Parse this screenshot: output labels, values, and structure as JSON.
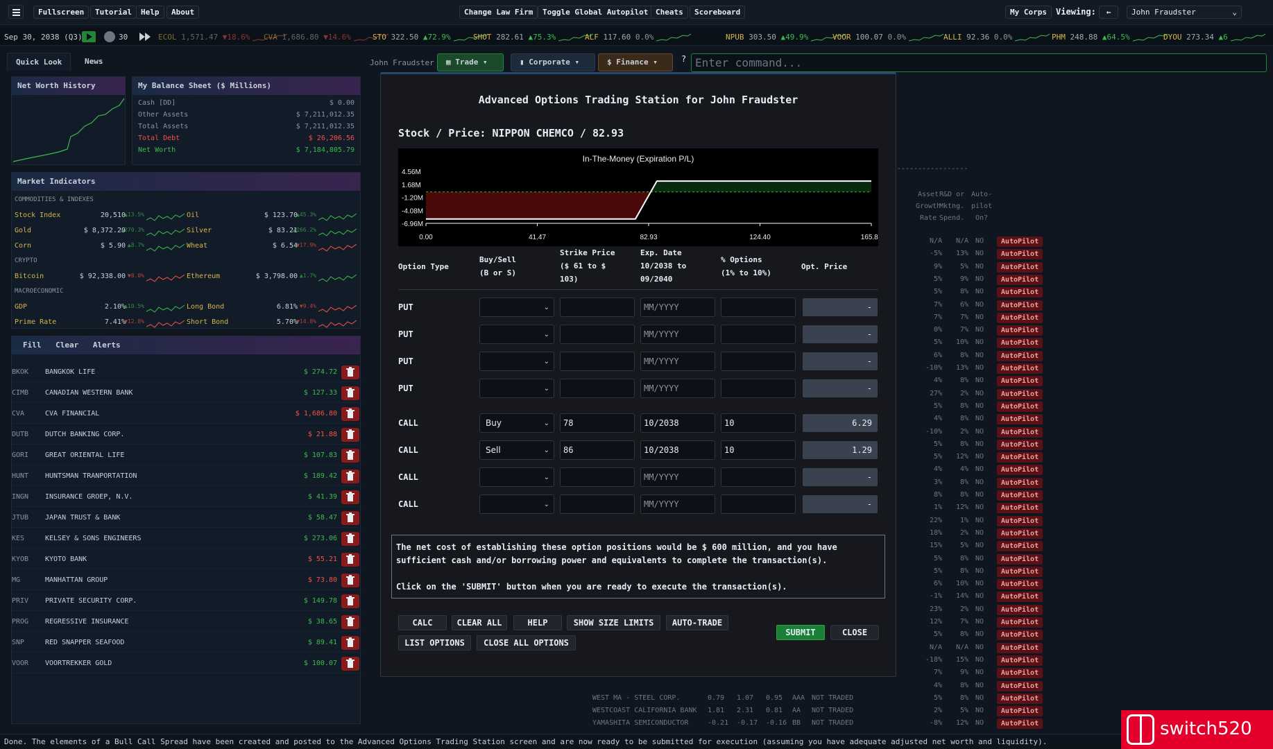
{
  "topbar": {
    "menu": [
      "Fullscreen",
      "Tutorial",
      "Help",
      "About"
    ],
    "center": [
      "Change Law Firm",
      "Toggle Global Autopilot",
      "Cheats",
      "Scoreboard"
    ],
    "my_corps": "My Corps",
    "viewing_label": "Viewing:",
    "back_label": "←",
    "viewing_value": "John Fraudster"
  },
  "ticker": {
    "date": "Sep 30, 2038 (Q3)",
    "speed": "30",
    "items": [
      {
        "sym": "ECOL",
        "price": "1,571.47",
        "chg": "▼18.6%",
        "dir": "dn"
      },
      {
        "sym": "CVA",
        "price": "1,686.80",
        "chg": "▼14.6%",
        "dir": "dn"
      },
      {
        "sym": "STO",
        "price": "322.50",
        "chg": "▲72.9%",
        "dir": "up"
      },
      {
        "sym": "SHOT",
        "price": "282.61",
        "chg": "▲75.3%",
        "dir": "up"
      },
      {
        "sym": "ALF",
        "price": "117.60",
        "chg": "0.0%",
        "dir": "gr"
      },
      {
        "sym": "NPUB",
        "price": "303.50",
        "chg": "▲49.9%",
        "dir": "up"
      },
      {
        "sym": "VOOR",
        "price": "100.07",
        "chg": "0.0%",
        "dir": "gr"
      },
      {
        "sym": "ALLI",
        "price": "92.36",
        "chg": "0.0%",
        "dir": "gr"
      },
      {
        "sym": "PHM",
        "price": "248.88",
        "chg": "▲64.5%",
        "dir": "up"
      },
      {
        "sym": "DYOU",
        "price": "273.34",
        "chg": "▲6",
        "dir": "up"
      }
    ]
  },
  "left": {
    "tabs": [
      "Quick Look",
      "News"
    ],
    "nw_title": "Net Worth History",
    "bs_title": "My Balance Sheet ($ Millions)",
    "bs_rows": [
      {
        "label": "Cash [DD]",
        "value": "$ 0.00",
        "color": "#8b949e"
      },
      {
        "label": "Other Assets",
        "value": "$ 7,211,012.35",
        "color": "#8b949e"
      },
      {
        "label": "Total Assets",
        "value": "$ 7,211,012.35",
        "color": "#8b949e"
      },
      {
        "label": "Total Debt",
        "value": "$ 26,206.56",
        "color": "#f85149"
      },
      {
        "label": "Net Worth",
        "value": "$ 7,184,805.79",
        "color": "#3fb950"
      }
    ],
    "mi_title": "Market Indicators",
    "mi_sections": {
      "a": "COMMODITIES & INDEXES",
      "b": "CRYPTO",
      "c": "MACROECONOMIC"
    },
    "mi_rows": [
      {
        "n": "Stock Index",
        "v": "20,510",
        "c": "▲13.5%",
        "d": "up"
      },
      {
        "n": "Oil",
        "v": "$ 123.70",
        "c": "▲45.3%",
        "d": "up"
      },
      {
        "n": "Gold",
        "v": "$ 8,372.29",
        "c": "▲270.3%",
        "d": "up"
      },
      {
        "n": "Silver",
        "v": "$ 83.21",
        "c": "▲166.2%",
        "d": "up"
      },
      {
        "n": "Corn",
        "v": "$ 5.90",
        "c": "▲8.7%",
        "d": "up"
      },
      {
        "n": "Wheat",
        "v": "$ 6.54",
        "c": "▼17.9%",
        "d": "dn"
      },
      {
        "n": "Bitcoin",
        "v": "$ 92,338.00",
        "c": "▼8.0%",
        "d": "dn"
      },
      {
        "n": "Ethereum",
        "v": "$ 3,798.00",
        "c": "▲1.7%",
        "d": "up"
      },
      {
        "n": "GDP",
        "v": "2.10%",
        "c": "▲10.5%",
        "d": "up"
      },
      {
        "n": "Long Bond",
        "v": "6.81%",
        "c": "▼9.4%",
        "d": "dn"
      },
      {
        "n": "Prime Rate",
        "v": "7.41%",
        "c": "▼12.8%",
        "d": "dn"
      },
      {
        "n": "Short Bond",
        "v": "5.70%",
        "c": "▼14.8%",
        "d": "dn"
      }
    ],
    "hold_tabs": [
      "Fill",
      "Clear",
      "Alerts"
    ],
    "holdings": [
      {
        "sym": "BKOK",
        "name": "BANGKOK LIFE",
        "val": "$ 274.72",
        "neg": false
      },
      {
        "sym": "CIMB",
        "name": "CANADIAN WESTERN BANK",
        "val": "$ 127.33",
        "neg": false
      },
      {
        "sym": "CVA",
        "name": "CVA FINANCIAL",
        "val": "$ 1,686.80",
        "neg": true
      },
      {
        "sym": "DUTB",
        "name": "DUTCH BANKING CORP.",
        "val": "$ 21.88",
        "neg": true
      },
      {
        "sym": "GORI",
        "name": "GREAT ORIENTAL LIFE",
        "val": "$ 107.83",
        "neg": false
      },
      {
        "sym": "HUNT",
        "name": "HUNTSMAN TRANPORTATION",
        "val": "$ 189.42",
        "neg": false
      },
      {
        "sym": "INGN",
        "name": "INSURANCE GROEP, N.V.",
        "val": "$ 41.39",
        "neg": false
      },
      {
        "sym": "JTUB",
        "name": "JAPAN TRUST & BANK",
        "val": "$ 58.47",
        "neg": false
      },
      {
        "sym": "KES",
        "name": "KELSEY & SONS ENGINEERS",
        "val": "$ 273.06",
        "neg": false
      },
      {
        "sym": "KYOB",
        "name": "KYOTO BANK",
        "val": "$ 55.21",
        "neg": true
      },
      {
        "sym": "MG",
        "name": "MANHATTAN GROUP",
        "val": "$ 73.80",
        "neg": true
      },
      {
        "sym": "PRIV",
        "name": "PRIVATE SECURITY CORP.",
        "val": "$ 149.78",
        "neg": false
      },
      {
        "sym": "PROG",
        "name": "REGRESSIVE INSURANCE",
        "val": "$ 38.65",
        "neg": false
      },
      {
        "sym": "SNP",
        "name": "RED SNAPPER SEAFOOD",
        "val": "$ 89.41",
        "neg": false
      },
      {
        "sym": "VOOR",
        "name": "VOORTREKKER GOLD",
        "val": "$ 100.07",
        "neg": false
      }
    ]
  },
  "context": {
    "user": "John Fraudster",
    "nav": [
      "Trade",
      "Corporate",
      "Finance"
    ],
    "help": "?",
    "command_placeholder": "Enter command..."
  },
  "bg": {
    "hdr": [
      "Asset",
      "Growth",
      "Rate",
      "R&D or",
      "Mktng.",
      "Spend.",
      "Auto-",
      "pilot",
      "On?"
    ],
    "rows": [
      {
        "name": "",
        "g": "N/A",
        "r": "N/A",
        "on": "NO"
      },
      {
        "name": "",
        "g": "-5%",
        "r": "13%",
        "on": "NO"
      },
      {
        "name": "",
        "g": "9%",
        "r": "5%",
        "on": "NO"
      },
      {
        "name": "",
        "g": "5%",
        "r": "9%",
        "on": "NO"
      },
      {
        "name": "",
        "g": "5%",
        "r": "8%",
        "on": "NO"
      },
      {
        "name": "",
        "g": "7%",
        "r": "6%",
        "on": "NO"
      },
      {
        "name": "",
        "g": "7%",
        "r": "7%",
        "on": "NO"
      },
      {
        "name": "",
        "g": "0%",
        "r": "7%",
        "on": "NO"
      },
      {
        "name": "",
        "g": "5%",
        "r": "10%",
        "on": "NO"
      },
      {
        "name": "",
        "g": "6%",
        "r": "8%",
        "on": "NO"
      },
      {
        "name": "",
        "g": "-10%",
        "r": "13%",
        "on": "NO"
      },
      {
        "name": "",
        "g": "4%",
        "r": "8%",
        "on": "NO"
      },
      {
        "name": "",
        "g": "27%",
        "r": "2%",
        "on": "NO"
      },
      {
        "name": "",
        "g": "5%",
        "r": "8%",
        "on": "NO"
      },
      {
        "name": "",
        "g": "4%",
        "r": "8%",
        "on": "NO"
      },
      {
        "name": "",
        "g": "-10%",
        "r": "2%",
        "on": "NO"
      },
      {
        "name": "",
        "g": "5%",
        "r": "8%",
        "on": "NO"
      },
      {
        "name": "",
        "g": "5%",
        "r": "12%",
        "on": "NO"
      },
      {
        "name": "",
        "g": "4%",
        "r": "4%",
        "on": "NO"
      },
      {
        "name": "",
        "g": "3%",
        "r": "8%",
        "on": "NO"
      },
      {
        "name": "",
        "g": "8%",
        "r": "8%",
        "on": "NO"
      },
      {
        "name": "",
        "g": "1%",
        "r": "12%",
        "on": "NO"
      },
      {
        "name": "",
        "g": "22%",
        "r": "1%",
        "on": "NO"
      },
      {
        "name": "",
        "g": "18%",
        "r": "2%",
        "on": "NO"
      },
      {
        "name": "",
        "g": "15%",
        "r": "5%",
        "on": "NO"
      },
      {
        "name": "",
        "g": "5%",
        "r": "8%",
        "on": "NO"
      },
      {
        "name": "",
        "g": "5%",
        "r": "8%",
        "on": "NO"
      },
      {
        "name": "",
        "g": "6%",
        "r": "10%",
        "on": "NO"
      },
      {
        "name": "",
        "g": "-1%",
        "r": "14%",
        "on": "NO"
      },
      {
        "name": "",
        "g": "23%",
        "r": "2%",
        "on": "NO"
      },
      {
        "name": "",
        "g": "12%",
        "r": "7%",
        "on": "NO"
      },
      {
        "name": "",
        "g": "5%",
        "r": "8%",
        "on": "NO"
      },
      {
        "name": "",
        "g": "N/A",
        "r": "N/A",
        "on": "NO"
      },
      {
        "name": "",
        "g": "-18%",
        "r": "15%",
        "on": "NO"
      },
      {
        "name": "",
        "g": "7%",
        "r": "9%",
        "on": "NO"
      },
      {
        "name": "",
        "g": "4%",
        "r": "8%",
        "on": "NO"
      },
      {
        "name": "WEST MA - STEEL CORP.",
        "g": "5%",
        "r": "8%",
        "on": "NO"
      },
      {
        "name": "WESTCOAST CALIFORNIA BANK",
        "g": "2%",
        "r": "5%",
        "on": "NO"
      },
      {
        "name": "YAMASHITA SEMICONDUCTOR",
        "g": "-8%",
        "r": "12%",
        "on": "NO"
      }
    ],
    "extra": [
      {
        "a": "0.79",
        "b": "1.07",
        "c": "0.95",
        "d": "AAA",
        "t": "NOT TRADED"
      },
      {
        "a": "1.81",
        "b": "2.31",
        "c": "0.81",
        "d": "AA",
        "t": "NOT TRADED"
      },
      {
        "a": "-0.21",
        "b": "-0.17",
        "c": "-0.16",
        "d": "BB",
        "t": "NOT TRADED"
      }
    ],
    "ap_label": "AutoPilot"
  },
  "modal": {
    "title": "Advanced Options Trading Station for John Fraudster",
    "stock_line": "Stock / Price: NIPPON CHEMCO / 82.93",
    "headers": {
      "type": "Option Type",
      "buysell": "Buy/Sell\n(B or S)",
      "strike": "Strike Price\n($ 61 to $\n103)",
      "exp": "Exp. Date\n10/2038 to\n09/2040",
      "pct": "% Options\n(1% to 10%)",
      "price": "Opt. Price"
    },
    "rows": [
      {
        "type": "PUT",
        "bs": "",
        "strike": "",
        "exp": "",
        "pct": "",
        "price": "-"
      },
      {
        "type": "PUT",
        "bs": "",
        "strike": "",
        "exp": "",
        "pct": "",
        "price": "-"
      },
      {
        "type": "PUT",
        "bs": "",
        "strike": "",
        "exp": "",
        "pct": "",
        "price": "-"
      },
      {
        "type": "PUT",
        "bs": "",
        "strike": "",
        "exp": "",
        "pct": "",
        "price": "-"
      },
      {
        "type": "CALL",
        "bs": "Buy",
        "strike": "78",
        "exp": "10/2038",
        "pct": "10",
        "price": "6.29"
      },
      {
        "type": "CALL",
        "bs": "Sell",
        "strike": "86",
        "exp": "10/2038",
        "pct": "10",
        "price": "1.29"
      },
      {
        "type": "CALL",
        "bs": "",
        "strike": "",
        "exp": "",
        "pct": "",
        "price": "-"
      },
      {
        "type": "CALL",
        "bs": "",
        "strike": "",
        "exp": "",
        "pct": "",
        "price": "-"
      }
    ],
    "exp_placeholder": "MM/YYYY",
    "message": "The net cost of establishing these option positions would be $ 600 million, and you have\nsufficient cash and/or borrowing power and equivalents to complete the transaction(s).\n\nClick on the 'SUBMIT' button when you are ready to execute the transaction(s).",
    "buttons": [
      "CALC",
      "CLEAR ALL",
      "HELP",
      "SHOW SIZE LIMITS",
      "AUTO-TRADE",
      "LIST OPTIONS",
      "CLOSE ALL OPTIONS"
    ],
    "submit": "SUBMIT",
    "close": "CLOSE"
  },
  "chart_data": {
    "type": "line",
    "title": "In-The-Money (Expiration P/L)",
    "x": [
      0.0,
      78,
      86,
      165.86
    ],
    "y": [
      -6.0,
      -6.0,
      2.4,
      2.4
    ],
    "xticks": [
      "0.00",
      "41.47",
      "82.93",
      "124.40",
      "165.86"
    ],
    "yticks": [
      "4.56M",
      "1.68M",
      "-1.20M",
      "-4.08M",
      "-6.96M"
    ],
    "xlim": [
      0,
      165.86
    ],
    "ylim": [
      -6.96,
      4.56
    ],
    "grid": false
  },
  "status": "Done. The elements of a Bull Call Spread have been created and posted to the Advanced Options Trading Station screen and are now ready to be submitted for execution (assuming you have adequate adjusted net worth and liquidity)."
}
